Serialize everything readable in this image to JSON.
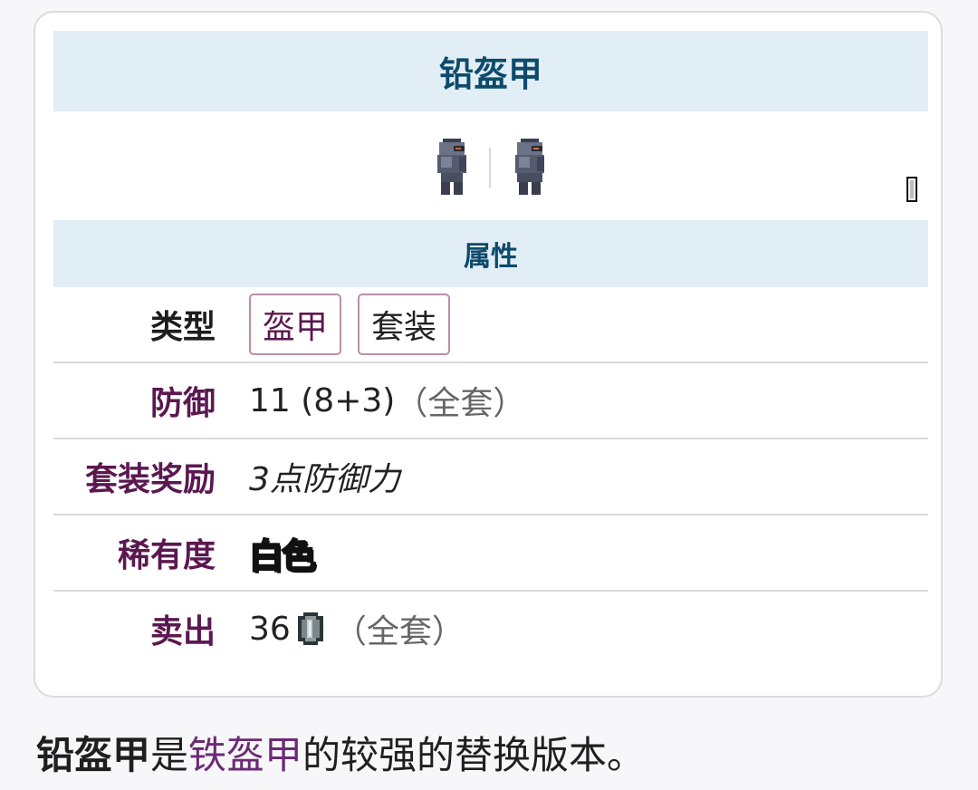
{
  "infobox": {
    "title": "铅盔甲",
    "icons": [
      "armor-sprite-male",
      "armor-sprite-female",
      "small-item-icon"
    ],
    "section_header": "属性",
    "rows": {
      "type": {
        "label": "类型",
        "tags": [
          "盔甲",
          "套装"
        ]
      },
      "defense": {
        "label": "防御",
        "value": "11 (8+3)",
        "note": "（全套）"
      },
      "set_bonus": {
        "label": "套装奖励",
        "value": "3点防御力"
      },
      "rarity": {
        "label": "稀有度",
        "value": "白色"
      },
      "sell": {
        "label": "卖出",
        "value": "36",
        "coin_icon": "silver-coin-icon",
        "note": "（全套）"
      }
    }
  },
  "description": {
    "bold": "铅盔甲",
    "part1": "是",
    "link": "铁盔甲",
    "part2": "的较强的替换版本。"
  },
  "colors": {
    "header_bg": "#e2eef6",
    "header_text": "#0e4a6b",
    "label_text": "#5b1850",
    "tag_border": "#b990ad",
    "link_text": "#6b2a75"
  }
}
